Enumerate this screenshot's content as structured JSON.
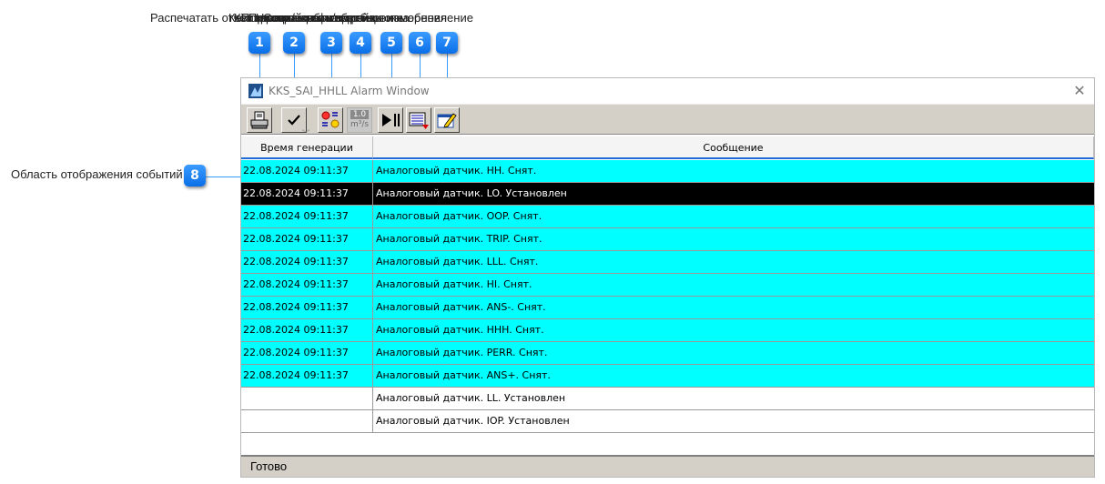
{
  "annotations": {
    "items": [
      {
        "number": "1",
        "text": "Распечатать отчёт"
      },
      {
        "number": "2",
        "text": "Квитировать событие"
      },
      {
        "number": "3",
        "text": "Квитировать все события"
      },
      {
        "number": "4",
        "text": "Показать/скрыть единицы измерения"
      },
      {
        "number": "5",
        "text": "Приостановить/возобновить обновление"
      },
      {
        "number": "6",
        "text": "Настройки фильтра"
      },
      {
        "number": "7",
        "text": "Сохранить настройки окна"
      }
    ],
    "event_area": {
      "number": "8",
      "text": "Область отображения событий"
    }
  },
  "window": {
    "title": "KKS_SAI_HHLL Alarm Window",
    "close_glyph": "✕"
  },
  "toolbar": {
    "units_top": "1.0",
    "units_bottom": "m³/s"
  },
  "table": {
    "columns": [
      "Время генерации",
      "Сообщение"
    ],
    "sort_glyph": "﹀",
    "rows": [
      {
        "time": "22.08.2024 09:11:37",
        "message": "Аналоговый датчик. HH. Снят.",
        "style": "cyan"
      },
      {
        "time": "22.08.2024 09:11:37",
        "message": "Аналоговый датчик. LO. Установлен",
        "style": "black"
      },
      {
        "time": "22.08.2024 09:11:37",
        "message": "Аналоговый датчик. OOP. Снят.",
        "style": "cyan"
      },
      {
        "time": "22.08.2024 09:11:37",
        "message": "Аналоговый датчик. TRIP. Снят.",
        "style": "cyan"
      },
      {
        "time": "22.08.2024 09:11:37",
        "message": "Аналоговый датчик. LLL. Снят.",
        "style": "cyan"
      },
      {
        "time": "22.08.2024 09:11:37",
        "message": "Аналоговый датчик. HI. Снят.",
        "style": "cyan"
      },
      {
        "time": "22.08.2024 09:11:37",
        "message": "Аналоговый датчик. ANS-. Снят.",
        "style": "cyan"
      },
      {
        "time": "22.08.2024 09:11:37",
        "message": "Аналоговый датчик. HHH. Снят.",
        "style": "cyan"
      },
      {
        "time": "22.08.2024 09:11:37",
        "message": "Аналоговый датчик. PERR. Снят.",
        "style": "cyan"
      },
      {
        "time": "22.08.2024 09:11:37",
        "message": "Аналоговый датчик. ANS+. Снят.",
        "style": "cyan"
      },
      {
        "time": "",
        "message": "Аналоговый датчик. LL. Установлен",
        "style": "white"
      },
      {
        "time": "",
        "message": "Аналоговый датчик. IOP. Установлен",
        "style": "white"
      }
    ]
  },
  "status": {
    "text": "Готово"
  },
  "colors": {
    "badge": "#0a6fe8",
    "row_cyan": "#00ffff",
    "row_selected": "#000000",
    "toolbar_bg": "#d4d0c8"
  }
}
